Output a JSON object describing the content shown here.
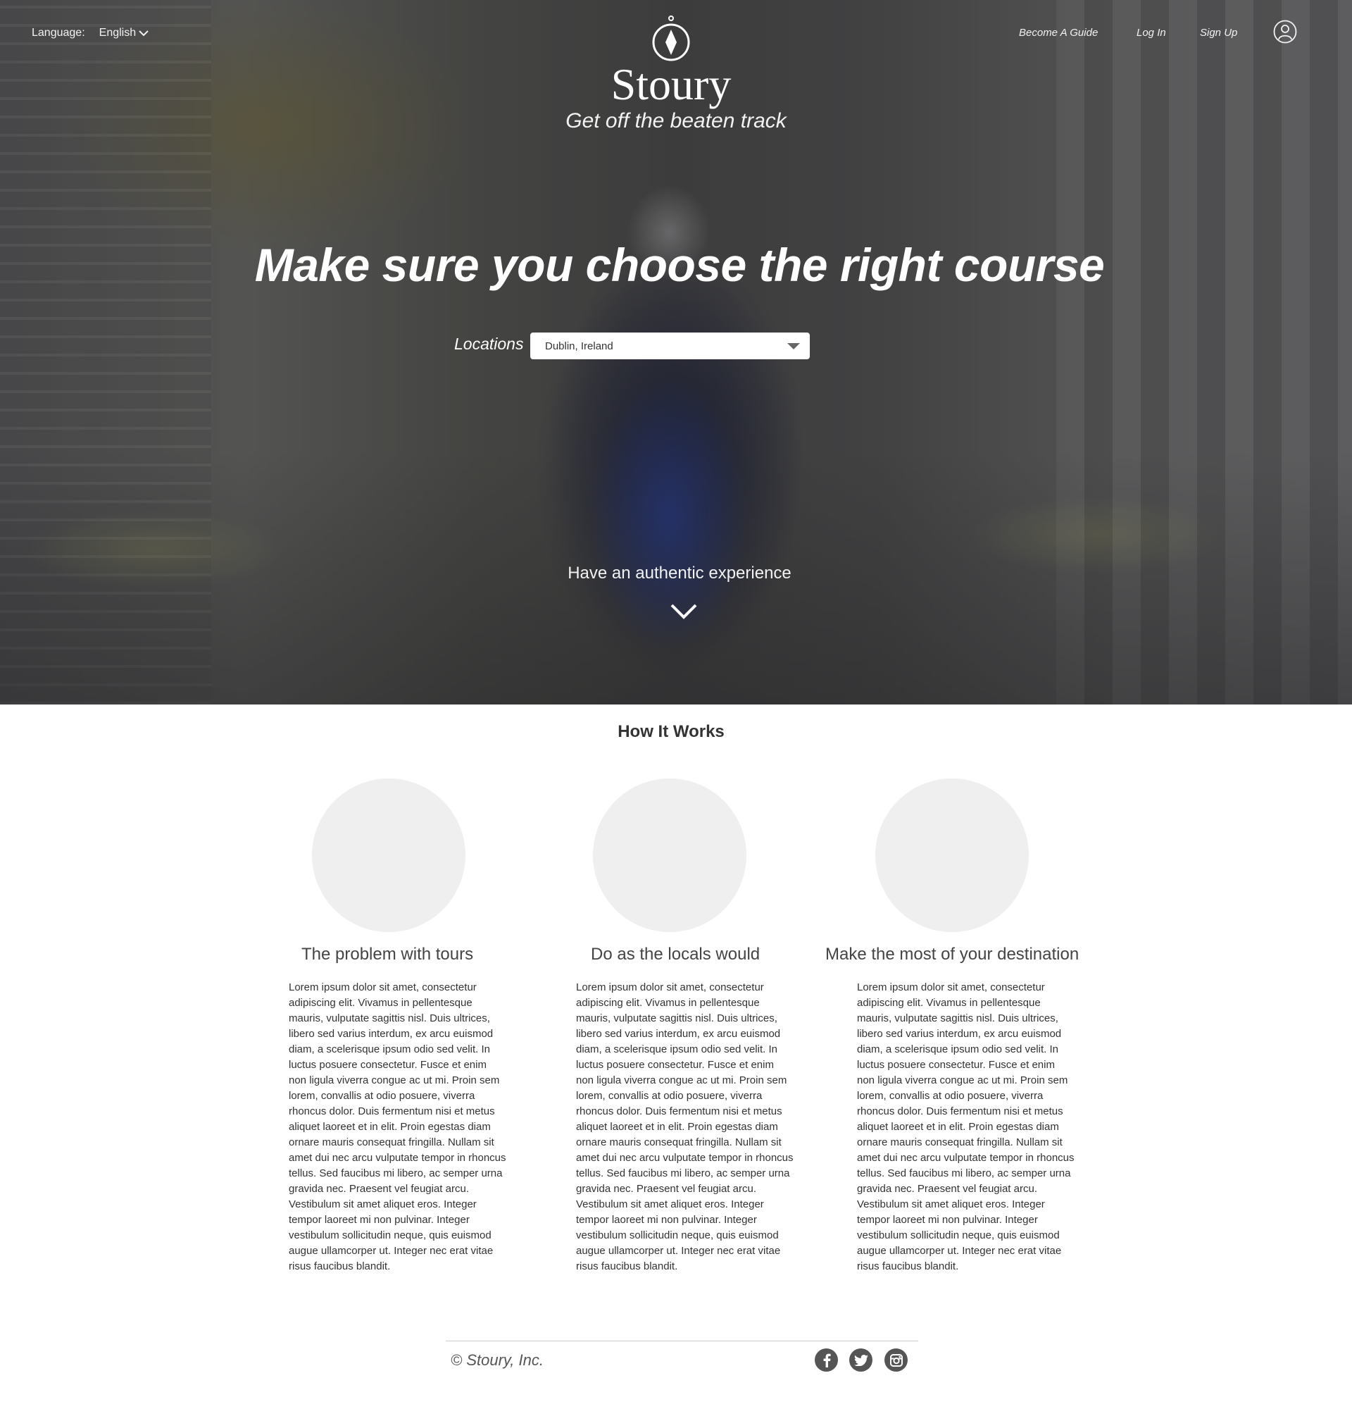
{
  "header": {
    "language_label": "Language:",
    "language_value": "English",
    "brand_name": "Stoury",
    "tagline": "Get off the beaten track",
    "nav": {
      "become_guide": "Become A Guide",
      "log_in": "Log In",
      "sign_up": "Sign Up"
    }
  },
  "hero": {
    "headline": "Make sure you choose the right course",
    "locations_label": "Locations",
    "location_value": "Dublin, Ireland",
    "subheading": "Have an authentic experience"
  },
  "how_it_works": {
    "title": "How It Works",
    "columns": [
      {
        "title": "The problem with tours",
        "body": "Lorem ipsum dolor sit amet, consectetur adipiscing elit. Vivamus in pellentesque mauris, vulputate sagittis nisl. Duis ultrices, libero sed varius interdum, ex arcu euismod diam, a scelerisque ipsum odio sed velit. In luctus posuere consectetur. Fusce et enim non ligula viverra congue ac ut mi. Proin sem lorem, convallis at odio posuere, viverra rhoncus dolor.  Duis fermentum nisi et metus aliquet laoreet et in elit. Proin egestas diam ornare mauris consequat fringilla. Nullam sit amet dui nec arcu vulputate tempor in rhoncus tellus. Sed faucibus mi libero, ac semper urna gravida nec. Praesent vel feugiat arcu. Vestibulum sit amet aliquet eros. Integer tempor laoreet mi non pulvinar. Integer vestibulum sollicitudin neque, quis euismod augue ullamcorper ut. Integer nec erat vitae risus faucibus blandit."
      },
      {
        "title": "Do as the locals would",
        "body": "Lorem ipsum dolor sit amet, consectetur adipiscing elit. Vivamus in pellentesque mauris, vulputate sagittis nisl. Duis ultrices, libero sed varius interdum, ex arcu euismod diam, a scelerisque ipsum odio sed velit. In luctus posuere consectetur. Fusce et enim non ligula viverra congue ac ut mi. Proin sem lorem, convallis at odio posuere, viverra rhoncus dolor.  Duis fermentum nisi et metus aliquet laoreet et in elit. Proin egestas diam ornare mauris consequat fringilla. Nullam sit amet dui nec arcu vulputate tempor in rhoncus tellus. Sed faucibus mi libero, ac semper urna gravida nec. Praesent vel feugiat arcu. Vestibulum sit amet aliquet eros. Integer tempor laoreet mi non pulvinar. Integer vestibulum sollicitudin neque, quis euismod augue ullamcorper ut. Integer nec erat vitae risus faucibus blandit."
      },
      {
        "title": "Make the most of your destination",
        "body": "Lorem ipsum dolor sit amet, consectetur adipiscing elit. Vivamus in pellentesque mauris, vulputate sagittis nisl. Duis ultrices, libero sed varius interdum, ex arcu euismod diam, a scelerisque ipsum odio sed velit. In luctus posuere consectetur. Fusce et enim non ligula viverra congue ac ut mi. Proin sem lorem, convallis at odio posuere, viverra rhoncus dolor.  Duis fermentum nisi et metus aliquet laoreet et in elit. Proin egestas diam ornare mauris consequat fringilla. Nullam sit amet dui nec arcu vulputate tempor in rhoncus tellus. Sed faucibus mi libero, ac semper urna gravida nec. Praesent vel feugiat arcu. Vestibulum sit amet aliquet eros. Integer tempor laoreet mi non pulvinar. Integer vestibulum sollicitudin neque, quis euismod augue ullamcorper ut. Integer nec erat vitae risus faucibus blandit."
      }
    ]
  },
  "footer": {
    "copyright": "©  Stoury, Inc.",
    "social_icons": [
      "facebook-icon",
      "twitter-icon",
      "instagram-icon"
    ]
  },
  "colors": {
    "hero_text": "#ffffff",
    "body_text": "#333333",
    "circle_placeholder": "#efefef",
    "social_bg": "#555555"
  }
}
